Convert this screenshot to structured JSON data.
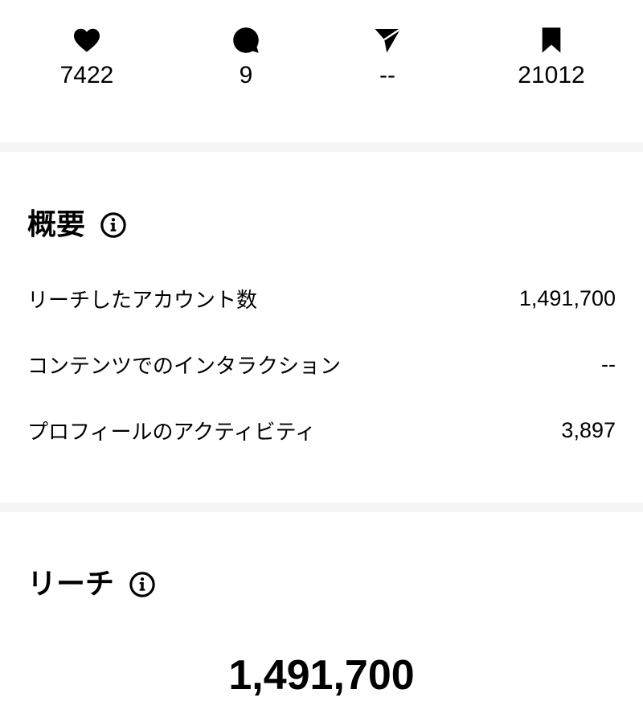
{
  "stats": [
    {
      "icon": "heart-icon",
      "value": "7422"
    },
    {
      "icon": "comment-icon",
      "value": "9"
    },
    {
      "icon": "send-icon",
      "value": "--"
    },
    {
      "icon": "bookmark-icon",
      "value": "21012"
    }
  ],
  "overview": {
    "title": "概要",
    "rows": [
      {
        "label": "リーチしたアカウント数",
        "value": "1,491,700"
      },
      {
        "label": "コンテンツでのインタラクション",
        "value": "--"
      },
      {
        "label": "プロフィールのアクティビティ",
        "value": "3,897"
      }
    ]
  },
  "reach": {
    "title": "リーチ",
    "total": "1,491,700"
  }
}
